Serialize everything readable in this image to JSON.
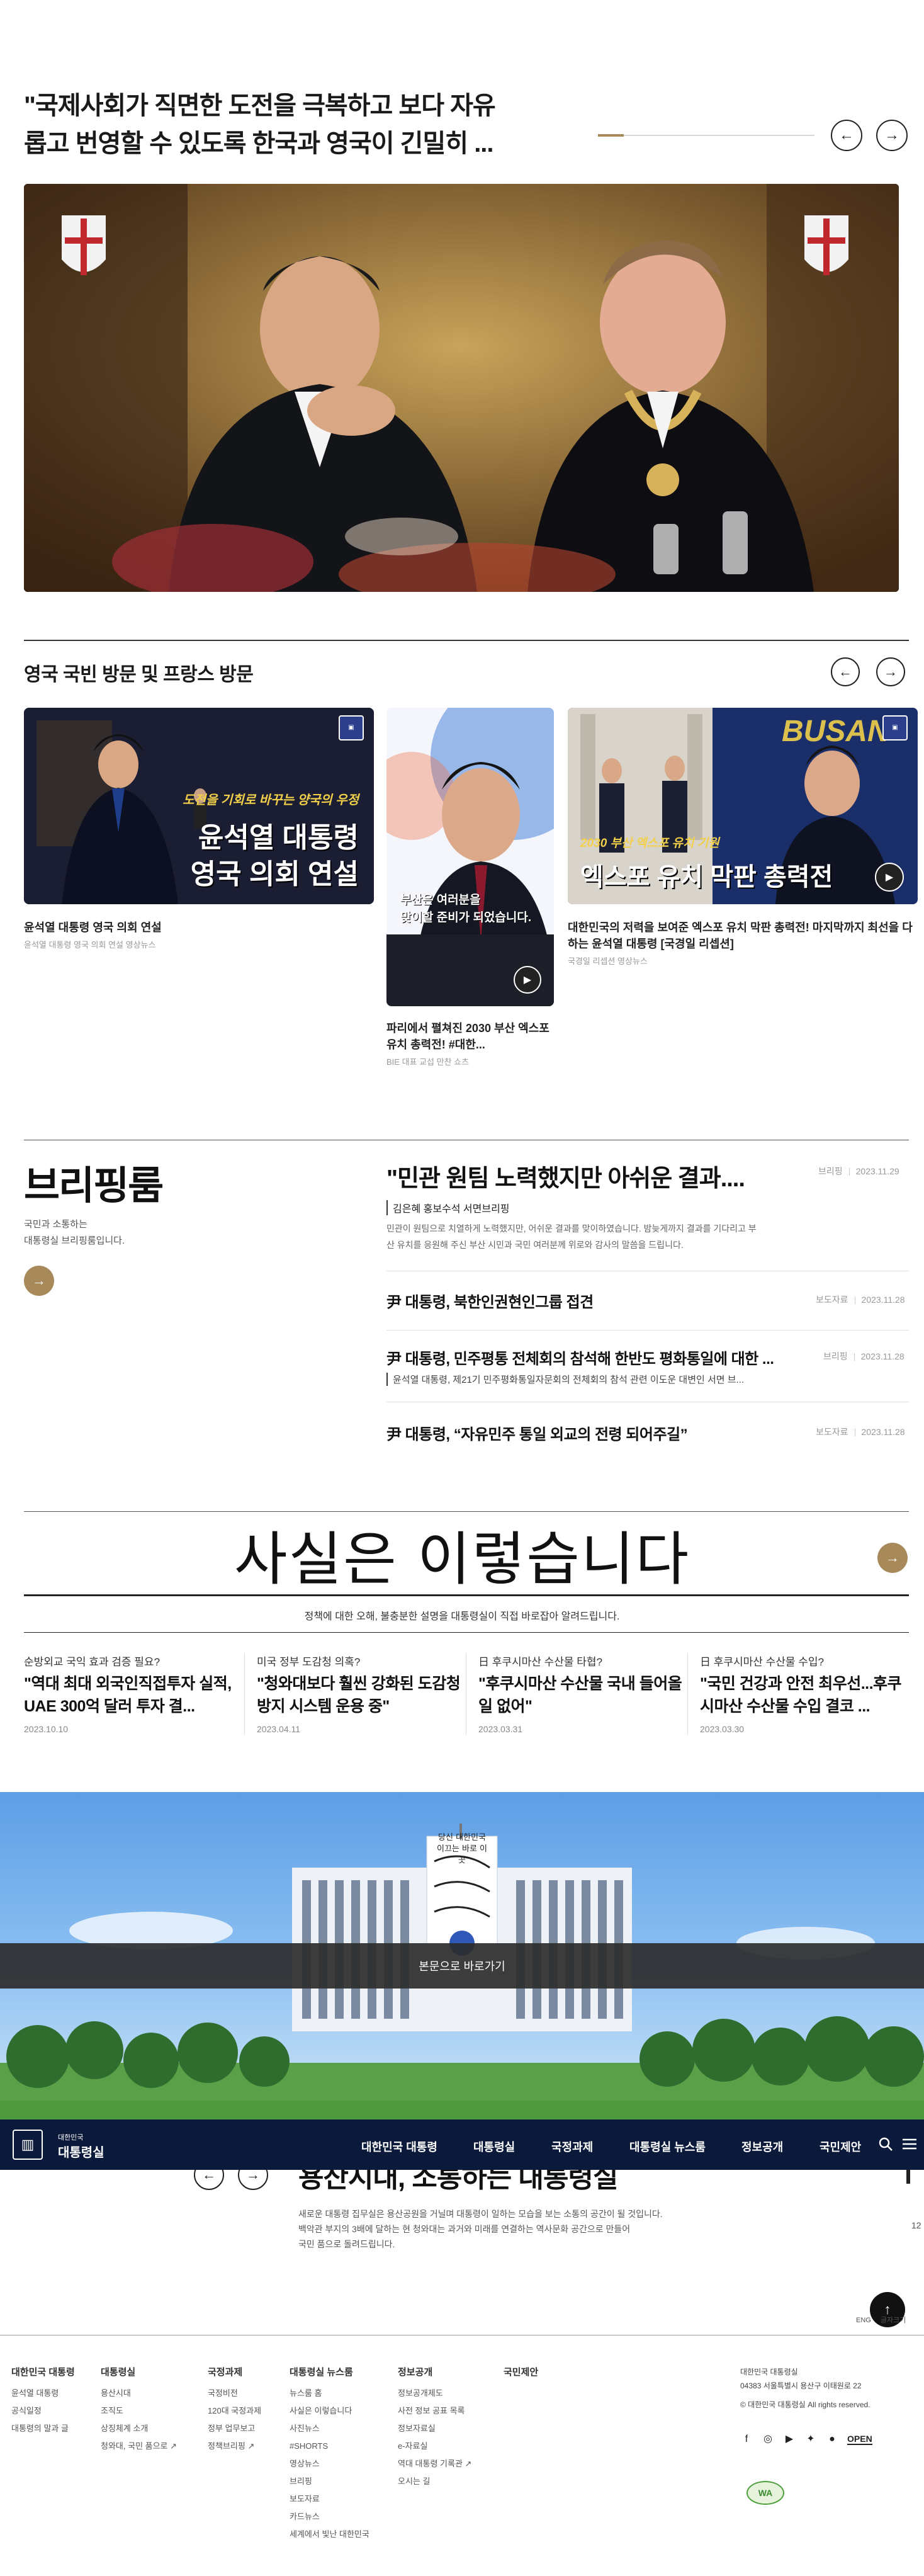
{
  "hero": {
    "quote_line1": "\"국제사회가 직면한 도전을 극복하고 보다 자유",
    "quote_line2": "롭고 번영할 수 있도록 한국과 영국이 긴밀히 ...",
    "progress": 0.12,
    "prev_icon": "←",
    "next_icon": "→"
  },
  "videos": {
    "section_title": "영국 국빈 방문 및 프랑스 방문",
    "items": [
      {
        "overlay_small": "도전을 기회로 바꾸는 양국의 우정",
        "overlay_line1": "윤석열 대통령",
        "overlay_line2": "영국 의회 연설",
        "title": "윤석열 대통령 영국 의회 연설",
        "sub": "윤석열 대통령 영국 의회 연설 영상뉴스"
      },
      {
        "overlay_line1": "부산은 여러분을",
        "overlay_line2": "맞이할 준비가 되었습니다.",
        "title": "파리에서 펼쳐진 2030 부산 엑스포 유치 총력전! #대한...",
        "sub": "BIE 대표 교섭 만찬 쇼츠"
      },
      {
        "overlay_small": "2030 부산 엑스포 유치 기원",
        "overlay_line1": "엑스포 유치 막판 총력전",
        "overlay_top": "BUSAN",
        "title": "대한민국의 저력을 보여준 엑스포 유치 막판 총력전! 마지막까지 최선을 다하는 윤석열 대통령 [국경일 리셉션]",
        "sub": "국경일 리셉션 영상뉴스"
      }
    ]
  },
  "briefing": {
    "heading": "브리핑룸",
    "desc_line1": "국민과 소통하는",
    "desc_line2": "대통령실 브리핑룸입니다.",
    "lead": {
      "title": "\"민관 원팀 노력했지만 아쉬운 결과....",
      "category": "브리핑",
      "date": "2023.11.29",
      "speaker": "김은혜 홍보수석 서면브리핑",
      "body_line1": "민관이 원팀으로 치열하게 노력했지만, 어쉬운 결과를 맞이하였습니다. 밤늦게까지 결과를 기다리고 부",
      "body_line2": "산 유치를 응원해 주신 부산 시민과 국민 여러분께 위로와 감사의 말씀을 드립니다."
    },
    "items": [
      {
        "title": "尹 대통령, 북한인권현인그룹 접견",
        "category": "보도자료",
        "date": "2023.11.28",
        "sub": ""
      },
      {
        "title": "尹 대통령, 민주평통 전체회의 참석해 한반도 평화통일에 대한 ...",
        "category": "브리핑",
        "date": "2023.11.28",
        "sub": "윤석열 대통령, 제21기 민주평화통일자문회의 전체회의 참석 관련 이도운 대변인 서면 브..."
      },
      {
        "title": "尹 대통령, “자유민주 통일 외교의 전령 되어주길”",
        "category": "보도자료",
        "date": "2023.11.28",
        "sub": ""
      }
    ]
  },
  "factcheck": {
    "title": "사실은 이렇습니다",
    "subtitle": "정책에 대한 오해, 불충분한 설명을 대통령실이 직접 바로잡아 알려드립니다.",
    "cards": [
      {
        "question": "순방외교 국익 효과 검증 필요?",
        "answer": "\"역대 최대 외국인직접투자 실적, UAE 300억 달러 투자 결...",
        "date": "2023.10.10"
      },
      {
        "question": "미국 정부 도감청 의혹?",
        "answer": "\"청와대보다 훨씬 강화된 도감청 방지 시스템 운용 중\"",
        "date": "2023.04.11"
      },
      {
        "question": "日 후쿠시마산 수산물 타협?",
        "answer": "\"후쿠시마산 수산물 국내 들어올 일 없어\"",
        "date": "2023.03.31"
      },
      {
        "question": "日 후쿠시마산 수산물 수입?",
        "answer": "\"국민 건강과 안전 최우선...후쿠시마산 수산물 수입 결코 ...",
        "date": "2023.03.30"
      }
    ]
  },
  "yongsan": {
    "sign_text": "당신 대한민국 이끄는 바로 이곳",
    "skip_link": "본문으로 바로가기",
    "heading": "용산시대, 소통하는 대통령실",
    "desc_line1": "새로운 대통령 집무실은 용산공원을 거닐며 대통령이 일하는 모습을 보는 소통의 공간이 될 것입니다.",
    "desc_line2": "백악관 부지의 3배에 달하는 현 청와대는 과거와 미래를 연결하는 역사문화 공간으로 만들어",
    "desc_line3": "국민 품으로 돌려드립니다.",
    "side_num": "12"
  },
  "nav": {
    "logo_small": "대한민국",
    "logo_big": "대통령실",
    "items": [
      "대한민국 대통령",
      "대통령실",
      "국정과제",
      "대통령실 뉴스룸",
      "정보공개",
      "국민제안"
    ],
    "search_icon": "search-icon",
    "menu_icon": "menu-icon"
  },
  "footer": {
    "lang_eng": "ENG",
    "lang_simple": "글자크기",
    "columns": [
      {
        "heading": "대한민국 대통령",
        "links": [
          "윤석열 대통령",
          "공식일정",
          "대통령의 말과 글"
        ]
      },
      {
        "heading": "대통령실",
        "links": [
          "용산시대",
          "조직도",
          "상징체계 소개",
          "청와대, 국민 품으로"
        ]
      },
      {
        "heading": "국정과제",
        "links": [
          "국정비전",
          "120대 국정과제",
          "정부 업무보고",
          "정책브리핑"
        ]
      },
      {
        "heading": "대통령실 뉴스룸",
        "links": [
          "뉴스룸 홈",
          "사실은 이렇습니다",
          "사진뉴스",
          "#SHORTS",
          "영상뉴스",
          "브리핑",
          "보도자료",
          "카드뉴스",
          "세계에서 빛난 대한민국"
        ]
      },
      {
        "heading": "정보공개",
        "links": [
          "정보공개제도",
          "사전 정보 공표 목록",
          "정보자료실",
          "e-자료실",
          "역대 대통령 기록관",
          "오시는 길"
        ]
      },
      {
        "heading": "국민제안",
        "links": []
      }
    ],
    "org_name": "대한민국 대통령실",
    "address": "04383 서울특별시 용산구 이태원로 22",
    "copyright": "© 대한민국 대통령실 All rights reserved.",
    "open_badge": "OPEN",
    "wa_badge": "WA",
    "top_icon": "↑"
  },
  "colors": {
    "accent": "#a88a5a",
    "nav_bg": "#0b1a3a"
  }
}
